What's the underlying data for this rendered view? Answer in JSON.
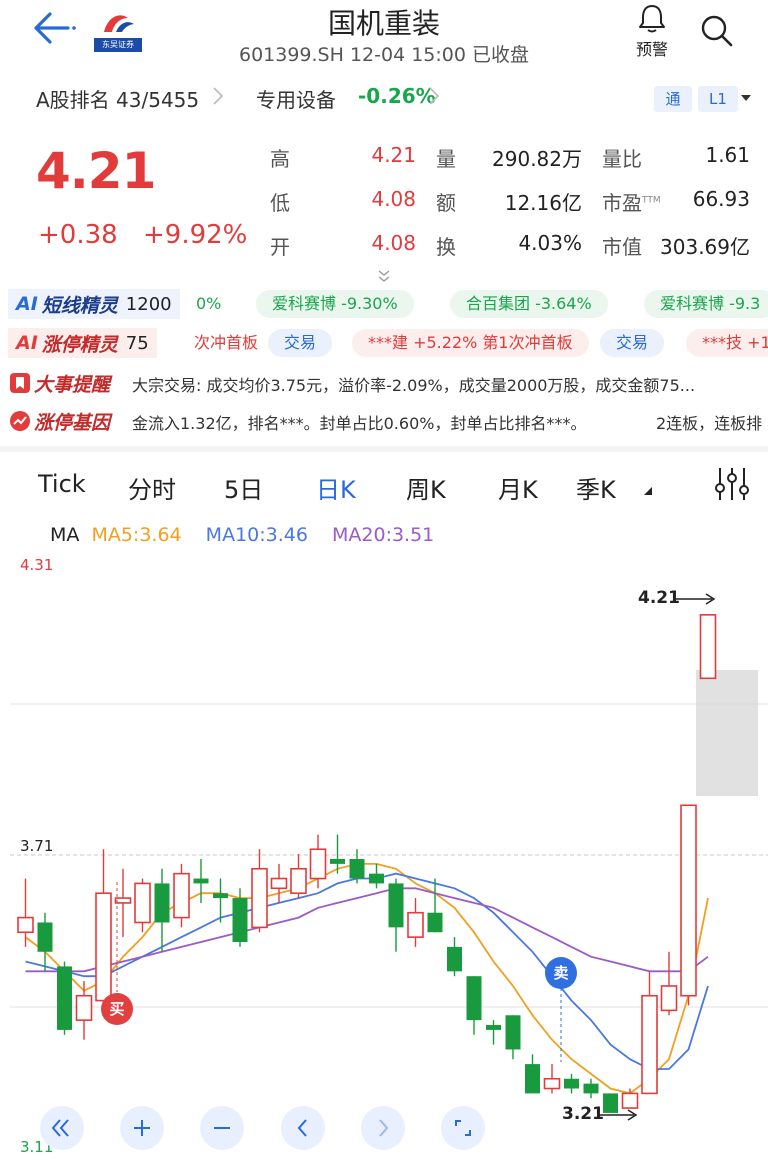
{
  "header": {
    "title": "国机重装",
    "subtitle": "601399.SH 12-04 15:00 已收盘",
    "logo_caption": "东吴证券",
    "alarm_label": "预警"
  },
  "rank_row": {
    "rank": "A股排名 43/5455",
    "industry": "专用设备",
    "industry_change": "-0.26%",
    "btn_tong": "通",
    "btn_level": "L1"
  },
  "quote": {
    "price": "4.21",
    "change_abs": "+0.38",
    "change_pct": "+9.92%",
    "fields": [
      {
        "label": "高",
        "value": "4.21"
      },
      {
        "label": "低",
        "value": "4.08"
      },
      {
        "label": "开",
        "value": "4.08"
      },
      {
        "label": "量",
        "value": "290.82万"
      },
      {
        "label": "额",
        "value": "12.16亿"
      },
      {
        "label": "换",
        "value": "4.03%"
      },
      {
        "label": "量比",
        "value": "1.61"
      },
      {
        "label": "市盈",
        "value": "66.93",
        "sup": "TTM"
      },
      {
        "label": "市值",
        "value": "303.69亿"
      }
    ]
  },
  "ai_short": {
    "ai": "AI",
    "name": "短线精灵",
    "count": "1200",
    "items": [
      "0%",
      "爱科赛博 -9.30%",
      "合百集团 -3.64%",
      "爱科赛博 -9.3"
    ]
  },
  "ai_limit": {
    "ai": "AI",
    "name": "涨停精灵",
    "count": "75",
    "items": [
      "次冲首板",
      "交易",
      "***建 +5.22% 第1次冲首板",
      "交易",
      "***技 +1"
    ]
  },
  "events": {
    "name": "大事提醒",
    "text": "大宗交易: 成交均价3.75元，溢价率-2.09%，成交量2000万股，成交金额75..."
  },
  "limit_gene": {
    "name": "涨停基因",
    "text": "金流入1.32亿，排名***。封单占比0.60%，封单占比排名***。",
    "text2": "2连板，连板排"
  },
  "tabs": [
    "Tick",
    "分时",
    "5日",
    "日K",
    "周K",
    "月K",
    "季K"
  ],
  "active_tab": "日K",
  "ma": {
    "label": "MA",
    "ma5": "MA5:3.64",
    "ma10": "MA10:3.46",
    "ma20": "MA20:3.51"
  },
  "colors": {
    "up": "#e23b3b",
    "down": "#1a9a3e",
    "ma5": "#f0a020",
    "ma10": "#4a78e0",
    "ma20": "#9b5bc6",
    "accent": "#2a6ad8"
  },
  "markers": {
    "buy": "买",
    "sell": "卖"
  },
  "chart_data": {
    "type": "candlestick",
    "y_axis_labels": [
      "4.31",
      "3.71",
      "3.11"
    ],
    "ylim": [
      3.11,
      4.31
    ],
    "annotations": {
      "high": "4.21",
      "low": "3.21"
    },
    "candles": [
      {
        "o": 3.56,
        "c": 3.59,
        "h": 3.67,
        "l": 3.53
      },
      {
        "o": 3.58,
        "c": 3.52,
        "h": 3.6,
        "l": 3.48
      },
      {
        "o": 3.49,
        "c": 3.36,
        "h": 3.5,
        "l": 3.35
      },
      {
        "o": 3.38,
        "c": 3.43,
        "h": 3.46,
        "l": 3.34
      },
      {
        "o": 3.42,
        "c": 3.64,
        "h": 3.73,
        "l": 3.41
      },
      {
        "o": 3.62,
        "c": 3.63,
        "h": 3.69,
        "l": 3.55
      },
      {
        "o": 3.58,
        "c": 3.66,
        "h": 3.67,
        "l": 3.56
      },
      {
        "o": 3.66,
        "c": 3.58,
        "h": 3.69,
        "l": 3.52
      },
      {
        "o": 3.59,
        "c": 3.68,
        "h": 3.7,
        "l": 3.57
      },
      {
        "o": 3.67,
        "c": 3.66,
        "h": 3.71,
        "l": 3.62
      },
      {
        "o": 3.64,
        "c": 3.63,
        "h": 3.67,
        "l": 3.58
      },
      {
        "o": 3.63,
        "c": 3.54,
        "h": 3.65,
        "l": 3.53
      },
      {
        "o": 3.57,
        "c": 3.69,
        "h": 3.73,
        "l": 3.56
      },
      {
        "o": 3.65,
        "c": 3.67,
        "h": 3.7,
        "l": 3.62
      },
      {
        "o": 3.64,
        "c": 3.69,
        "h": 3.72,
        "l": 3.63
      },
      {
        "o": 3.67,
        "c": 3.73,
        "h": 3.76,
        "l": 3.65
      },
      {
        "o": 3.71,
        "c": 3.7,
        "h": 3.76,
        "l": 3.68
      },
      {
        "o": 3.71,
        "c": 3.67,
        "h": 3.73,
        "l": 3.66
      },
      {
        "o": 3.68,
        "c": 3.66,
        "h": 3.7,
        "l": 3.65
      },
      {
        "o": 3.66,
        "c": 3.57,
        "h": 3.67,
        "l": 3.52
      },
      {
        "o": 3.55,
        "c": 3.6,
        "h": 3.63,
        "l": 3.53
      },
      {
        "o": 3.6,
        "c": 3.56,
        "h": 3.67,
        "l": 3.56
      },
      {
        "o": 3.53,
        "c": 3.48,
        "h": 3.55,
        "l": 3.47
      },
      {
        "o": 3.47,
        "c": 3.38,
        "h": 3.47,
        "l": 3.35
      },
      {
        "o": 3.37,
        "c": 3.36,
        "h": 3.38,
        "l": 3.33
      },
      {
        "o": 3.39,
        "c": 3.32,
        "h": 3.39,
        "l": 3.3
      },
      {
        "o": 3.29,
        "c": 3.23,
        "h": 3.31,
        "l": 3.23
      },
      {
        "o": 3.24,
        "c": 3.26,
        "h": 3.29,
        "l": 3.23
      },
      {
        "o": 3.26,
        "c": 3.24,
        "h": 3.27,
        "l": 3.23
      },
      {
        "o": 3.25,
        "c": 3.23,
        "h": 3.26,
        "l": 3.22
      },
      {
        "o": 3.23,
        "c": 3.19,
        "h": 3.23,
        "l": 3.19
      },
      {
        "o": 3.2,
        "c": 3.23,
        "h": 3.24,
        "l": 3.21
      },
      {
        "o": 3.23,
        "c": 3.43,
        "h": 3.48,
        "l": 3.23
      },
      {
        "o": 3.4,
        "c": 3.45,
        "h": 3.52,
        "l": 3.39
      },
      {
        "o": 3.43,
        "c": 3.82,
        "h": 3.82,
        "l": 3.41
      },
      {
        "o": 4.08,
        "c": 4.21,
        "h": 4.21,
        "l": 4.08
      }
    ],
    "ma5": [
      3.55,
      3.52,
      3.48,
      3.44,
      3.46,
      3.51,
      3.55,
      3.6,
      3.62,
      3.64,
      3.64,
      3.63,
      3.63,
      3.64,
      3.65,
      3.67,
      3.69,
      3.7,
      3.7,
      3.69,
      3.66,
      3.64,
      3.61,
      3.56,
      3.5,
      3.45,
      3.39,
      3.34,
      3.3,
      3.27,
      3.24,
      3.23,
      3.26,
      3.3,
      3.43,
      3.63
    ],
    "ma10": [
      3.5,
      3.49,
      3.48,
      3.47,
      3.47,
      3.49,
      3.51,
      3.53,
      3.55,
      3.57,
      3.59,
      3.6,
      3.61,
      3.62,
      3.63,
      3.64,
      3.66,
      3.67,
      3.67,
      3.68,
      3.67,
      3.66,
      3.65,
      3.63,
      3.6,
      3.56,
      3.52,
      3.47,
      3.42,
      3.38,
      3.33,
      3.3,
      3.28,
      3.28,
      3.32,
      3.45
    ],
    "ma20": [
      3.48,
      3.48,
      3.48,
      3.48,
      3.49,
      3.5,
      3.51,
      3.52,
      3.53,
      3.54,
      3.55,
      3.56,
      3.57,
      3.58,
      3.59,
      3.61,
      3.62,
      3.63,
      3.64,
      3.65,
      3.65,
      3.64,
      3.63,
      3.62,
      3.61,
      3.59,
      3.57,
      3.55,
      3.53,
      3.51,
      3.5,
      3.49,
      3.48,
      3.48,
      3.48,
      3.51
    ]
  },
  "controls": [
    "fast-back",
    "zoom-in",
    "zoom-out",
    "prev",
    "next",
    "fullscreen"
  ]
}
